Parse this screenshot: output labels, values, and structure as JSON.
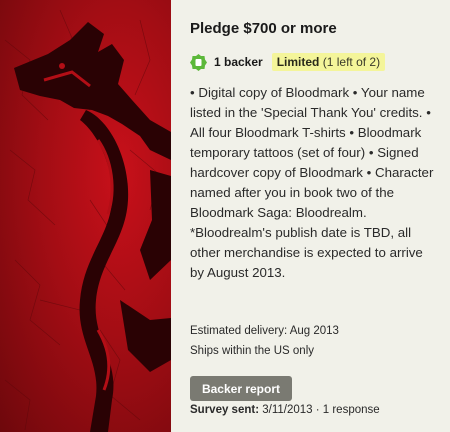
{
  "reward": {
    "title": "Pledge $700 or more",
    "backers": "1 backer",
    "limited_label": "Limited",
    "limited_detail": "(1 left of 2)",
    "description": "• Digital copy of Bloodmark • Your name listed in the 'Special Thank You' credits. • All four Bloodmark T-shirts • Bloodmark temporary tattoos (set of four) • Signed hardcover copy of Bloodmark • Character named after you in book two of the Bloodmark Saga: Bloodrealm. *Bloodrealm's publish date is TBD, all other merchandise is expected to arrive by August 2013.",
    "estimated_delivery": "Estimated delivery: Aug 2013",
    "shipping": "Ships within the US only",
    "backer_report_label": "Backer report",
    "survey_label": "Survey sent:",
    "survey_value": "3/11/2013 · 1 response"
  },
  "colors": {
    "background": "#f1f1e9",
    "art_red": "#b30e16",
    "badge_green": "#5cb83a",
    "limited_bg": "#f4f59a",
    "button_gray": "#7a7a72"
  },
  "icons": {
    "backer_badge": "badge-icon"
  }
}
